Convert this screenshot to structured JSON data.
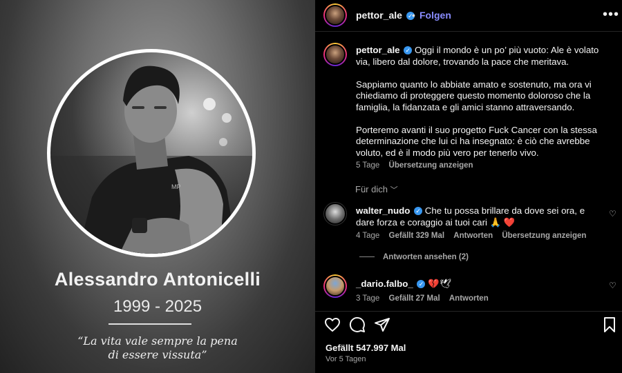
{
  "post_image": {
    "name": "Alessandro Antonicelli",
    "years": "1999 - 2025",
    "quote_line1": "“La vita vale sempre la pena",
    "quote_line2": "di essere vissuta”",
    "shirt_logo": "MP"
  },
  "header": {
    "username": "pettor_ale",
    "separator": "•",
    "follow_label": "Folgen",
    "more_icon": "more-horizontal-icon"
  },
  "caption": {
    "username": "pettor_ale",
    "paragraph1": "Oggi il mondo è un po’ più vuoto: Ale è volato via, libero dal dolore, trovando la pace che meritava.",
    "paragraph2": "Sappiamo quanto lo abbiate amato e sostenuto, ma ora vi chiediamo di proteggere questo momento doloroso che la famiglia, la fidanzata e gli amici stanno attraversando.",
    "paragraph3": "Porteremo avanti il suo progetto Fuck Cancer con la stessa determinazione che lui ci ha insegnato: è ciò che avrebbe voluto, ed è il modo più vero per tenerlo vivo.",
    "age": "5 Tage",
    "translate": "Übersetzung anzeigen"
  },
  "for_you_label": "Für dich",
  "comments": [
    {
      "username": "walter_nudo",
      "text": "Che tu possa brillare da dove sei ora, e dare forza e coraggio ai tuoi cari 🙏 ❤️",
      "age": "4 Tage",
      "likes": "Gefällt 329 Mal",
      "reply": "Antworten",
      "translate": "Übersetzung anzeigen",
      "view_replies": "Antworten ansehen (2)"
    },
    {
      "username": "_dario.falbo_",
      "text": "💔🕊",
      "age": "3 Tage",
      "likes": "Gefällt 27 Mal",
      "reply": "Antworten"
    }
  ],
  "footer": {
    "likes": "Gefällt 547.997 Mal",
    "time": "Vor 5 Tagen"
  }
}
